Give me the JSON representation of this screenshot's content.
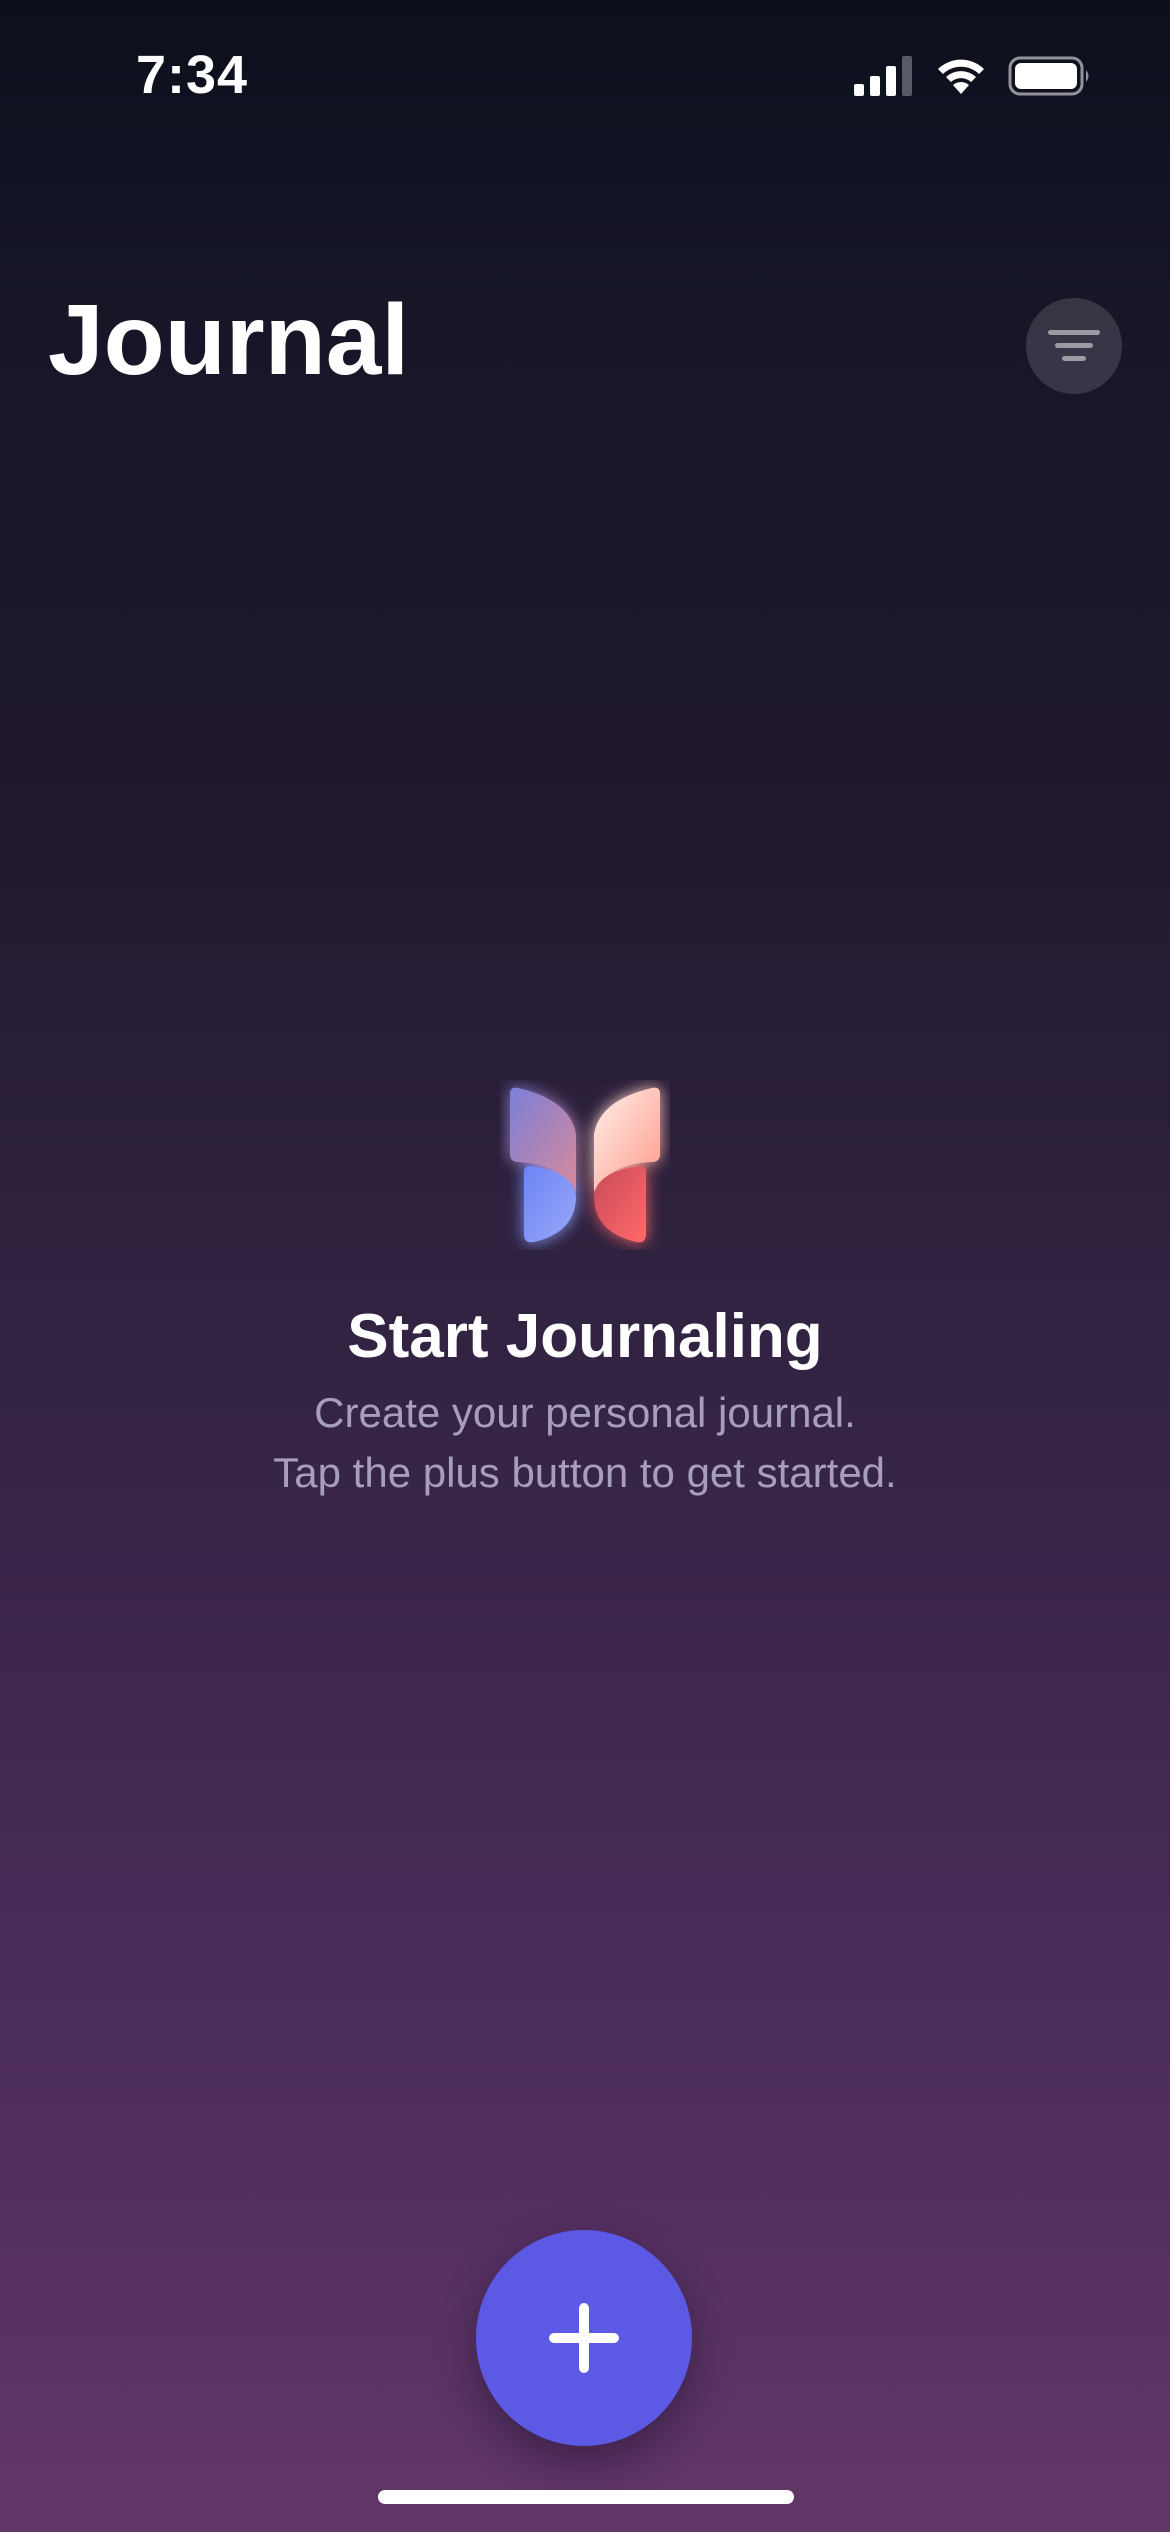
{
  "status_bar": {
    "time": "7:34",
    "icons": [
      "cellular-signal-icon",
      "wifi-icon",
      "battery-icon"
    ]
  },
  "header": {
    "title": "Journal",
    "filter_icon": "filter-lines-icon"
  },
  "empty_state": {
    "logo_icon": "journal-app-logo",
    "title": "Start Journaling",
    "line1": "Create your personal journal.",
    "line2": "Tap the plus button to get started."
  },
  "add_button": {
    "icon": "plus-icon",
    "color": "#5c59e4"
  },
  "colors": {
    "background_top": "#0c0f1c",
    "background_bottom": "#623768",
    "subtitle_text": "#a79fb9"
  }
}
